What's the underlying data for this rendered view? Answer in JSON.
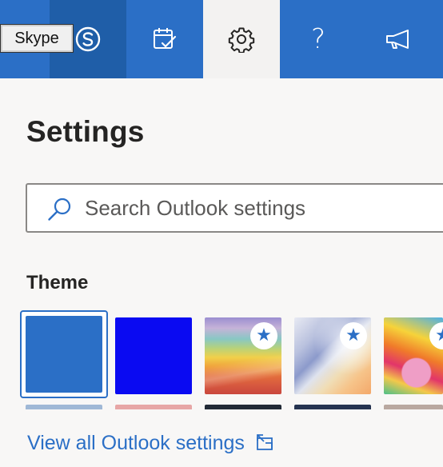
{
  "header": {
    "tooltip": "Skype",
    "buttons": [
      {
        "name": "skype",
        "icon": "skype-icon"
      },
      {
        "name": "my-day",
        "icon": "calendar-check-icon"
      },
      {
        "name": "settings",
        "icon": "gear-icon"
      },
      {
        "name": "help",
        "icon": "question-mark-icon",
        "glyph": "?"
      },
      {
        "name": "feedback",
        "icon": "megaphone-icon"
      }
    ],
    "colors": {
      "bar": "#2b6fc6",
      "active_bg": "#f3f2f1",
      "skype_bg": "#1f5ea8"
    }
  },
  "settings": {
    "title": "Settings",
    "search": {
      "placeholder": "Search Outlook settings",
      "value": ""
    },
    "theme_title": "Theme",
    "themes": [
      {
        "name": "blue",
        "color": "#2b6fc6",
        "selected": true,
        "premium": false
      },
      {
        "name": "bright-blue",
        "color": "#0a0af2",
        "selected": false,
        "premium": false
      },
      {
        "name": "rainbow",
        "selected": false,
        "premium": true
      },
      {
        "name": "ribbon",
        "selected": false,
        "premium": true
      },
      {
        "name": "unicorn",
        "selected": false,
        "premium": true
      }
    ],
    "premium_badge_glyph": "★",
    "view_all_link": "View all Outlook settings",
    "colors": {
      "accent": "#2b6fc6",
      "background": "#f8f7f6",
      "text": "#252423"
    }
  }
}
